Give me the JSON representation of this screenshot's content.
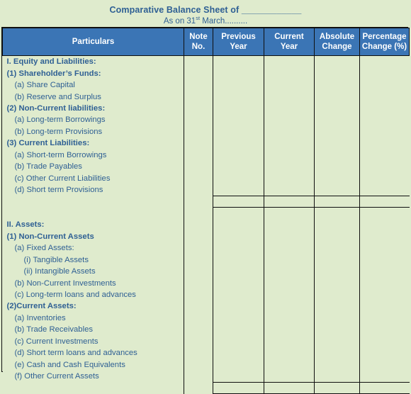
{
  "document": {
    "title_prefix": "Comparative Balance Sheet of ",
    "title_blank": "____________",
    "subtitle_prefix": "As on 31",
    "subtitle_sup": "st",
    "subtitle_suffix": " March.........."
  },
  "colors": {
    "header_blue": "#3b75b5",
    "body_green": "#dfebcd",
    "text_blue": "#2f6094",
    "border": "#0f0f0f",
    "header_text": "#ffffff"
  },
  "table": {
    "columns": [
      {
        "key": "particulars",
        "label": "Particulars"
      },
      {
        "key": "note_no",
        "label": "Note\nNo.",
        "line1": "Note",
        "line2": "No."
      },
      {
        "key": "previous_year",
        "label": "Previous\nYear",
        "line1": "Previous",
        "line2": "Year"
      },
      {
        "key": "current_year",
        "label": "Current\nYear",
        "line1": "Current",
        "line2": "Year"
      },
      {
        "key": "absolute_change",
        "label": "Absolute\nChange",
        "line1": "Absolute",
        "line2": "Change"
      },
      {
        "key": "percentage_change",
        "label": "Percentage\nChange (%)",
        "line1": "Percentage",
        "line2": "Change (%)"
      }
    ],
    "rows": [
      {
        "label": "I. Equity and Liabilities:",
        "level": "head"
      },
      {
        "label": "(1) Shareholder’s Funds:",
        "level": "head"
      },
      {
        "label": "(a) Share Capital",
        "level": "sub"
      },
      {
        "label": "(b) Reserve and Surplus",
        "level": "sub"
      },
      {
        "label": "(2) Non-Current liabilities:",
        "level": "head"
      },
      {
        "label": "(a) Long-term Borrowings",
        "level": "sub"
      },
      {
        "label": "(b) Long-term Provisions",
        "level": "sub"
      },
      {
        "label": "(3) Current Liabilities:",
        "level": "head"
      },
      {
        "label": "(a) Short-term Borrowings",
        "level": "sub"
      },
      {
        "label": "(b) Trade Payables",
        "level": "sub"
      },
      {
        "label": "(c) Other Current Liabilities",
        "level": "sub"
      },
      {
        "label": "(d) Short term Provisions",
        "level": "sub"
      },
      {
        "label": "",
        "level": "blank",
        "divider": true
      },
      {
        "label": "",
        "level": "blank",
        "divider": true
      },
      {
        "label": "II. Assets:",
        "level": "head"
      },
      {
        "label": "(1) Non-Current Assets",
        "level": "head"
      },
      {
        "label": "(a) Fixed Assets:",
        "level": "sub"
      },
      {
        "label": "(i) Tangible Assets",
        "level": "sub2"
      },
      {
        "label": "(ii) Intangible Assets",
        "level": "sub2"
      },
      {
        "label": "(b) Non-Current Investments",
        "level": "sub"
      },
      {
        "label": "(c) Long-term loans and advances",
        "level": "sub"
      },
      {
        "label": "(2)Current Assets:",
        "level": "head"
      },
      {
        "label": "(a) Inventories",
        "level": "sub"
      },
      {
        "label": "(b) Trade Receivables",
        "level": "sub"
      },
      {
        "label": "(c) Current Investments",
        "level": "sub"
      },
      {
        "label": "(d) Short term loans and advances",
        "level": "sub"
      },
      {
        "label": "(e) Cash and Cash Equivalents",
        "level": "sub"
      },
      {
        "label": "(f) Other Current Assets",
        "level": "sub"
      },
      {
        "label": "",
        "level": "blank",
        "divider": true
      }
    ]
  }
}
